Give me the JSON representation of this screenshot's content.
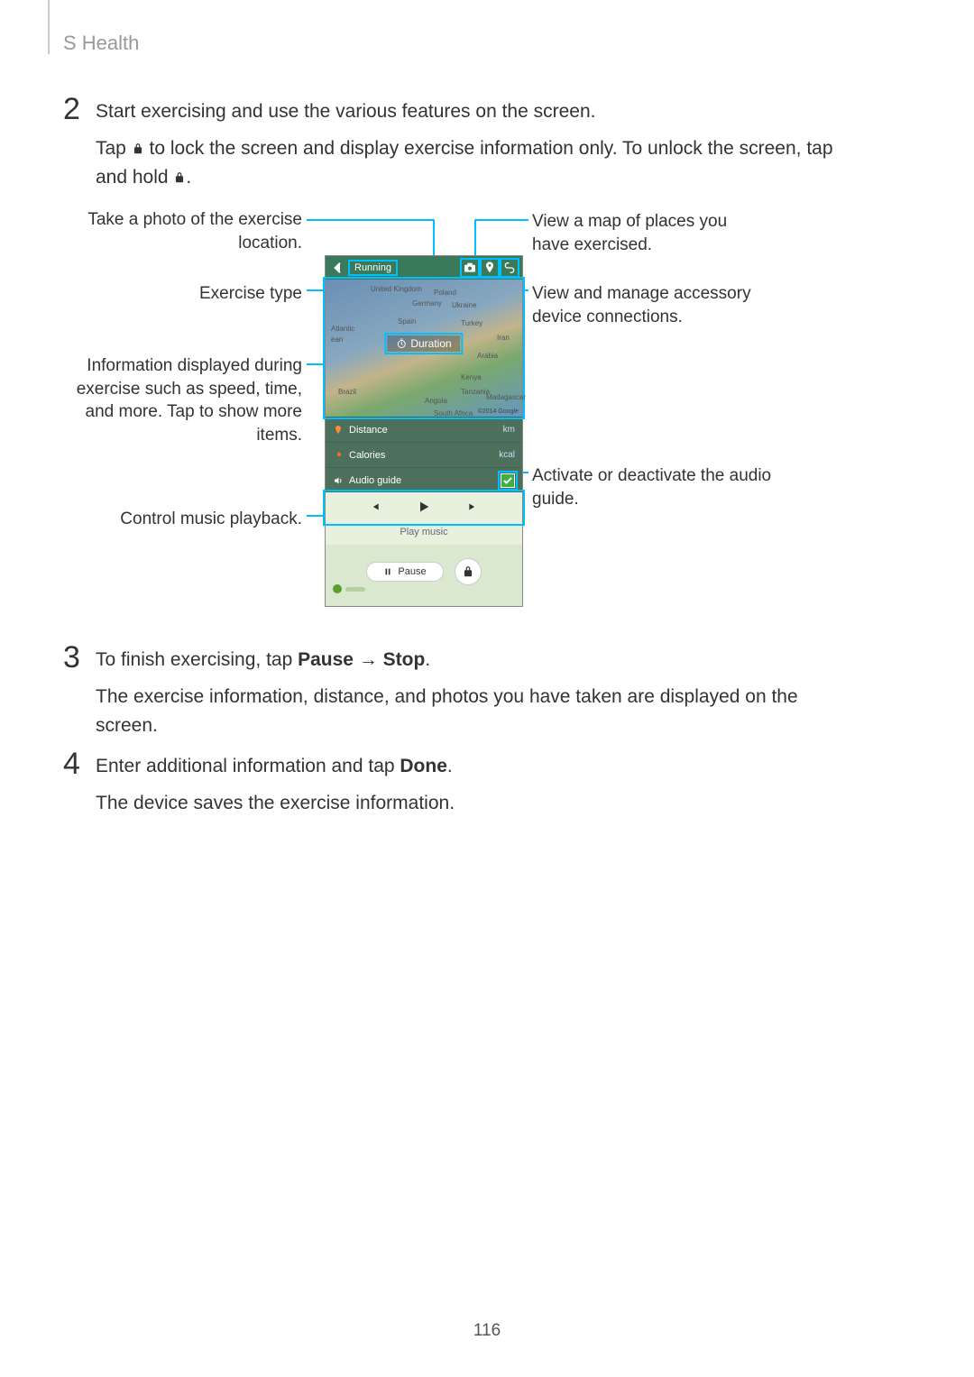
{
  "header": {
    "title": "S Health"
  },
  "steps": {
    "s2": {
      "num": "2",
      "p1": "Start exercising and use the various features on the screen.",
      "p2a": "Tap ",
      "p2b": " to lock the screen and display exercise information only. To unlock the screen, tap and hold ",
      "p2c": "."
    },
    "s3": {
      "num": "3",
      "p1a": "To finish exercising, tap ",
      "p1_pause": "Pause",
      "p1_arrow": " → ",
      "p1_stop": "Stop",
      "p1b": ".",
      "p2": "The exercise information, distance, and photos you have taken are displayed on the screen."
    },
    "s4": {
      "num": "4",
      "p1a": "Enter additional information and tap ",
      "p1_done": "Done",
      "p1b": ".",
      "p2": "The device saves the exercise information."
    }
  },
  "callouts": {
    "left": {
      "photo": "Take a photo of the exercise location.",
      "type": "Exercise type",
      "info": "Information displayed during exercise such as speed, time, and more. Tap to show more items.",
      "music": "Control music playback."
    },
    "right": {
      "map": "View a map of places you have exercised.",
      "accessory": "View and manage accessory device connections.",
      "audio": "Activate or deactivate the audio guide."
    }
  },
  "phone": {
    "back_label": "Running",
    "duration_label": "Duration",
    "distance_label": "Distance",
    "distance_unit": "km",
    "calories_label": "Calories",
    "calories_unit": "kcal",
    "audio_label": "Audio guide",
    "play_music": "Play music",
    "pause": "Pause",
    "map_labels": [
      "United Kingdom",
      "Poland",
      "Germany",
      "Ukraine",
      "Spain",
      "Turkey",
      "Atlantic",
      "ean",
      "Iran",
      "Arabia",
      "Kenya",
      "Tanzania",
      "Angola",
      "Brazil",
      "Madagascar",
      "South Africa"
    ],
    "copyright": "©2014 Google"
  },
  "page_number": "116"
}
